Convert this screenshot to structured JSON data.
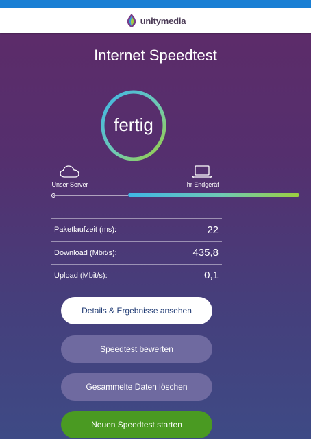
{
  "header": {
    "logo_text": "unitymedia"
  },
  "title": "Internet Speedtest",
  "gauge": {
    "status": "fertig"
  },
  "endpoints": {
    "server_label": "Unser Server",
    "device_label": "Ihr Endgerät"
  },
  "progress": {
    "fraction_complete": 0.69
  },
  "results": [
    {
      "label": "Paketlaufzeit (ms):",
      "value": "22"
    },
    {
      "label": "Download (Mbit/s):",
      "value": "435,8"
    },
    {
      "label": "Upload (Mbit/s):",
      "value": "0,1"
    }
  ],
  "buttons": {
    "details": "Details & Ergebnisse ansehen",
    "rate": "Speedtest bewerten",
    "clear": "Gesammelte Daten löschen",
    "new_test": "Neuen Speedtest starten"
  },
  "colors": {
    "brand_blue": "#1a7fd4",
    "gauge_start": "#3fb6e6",
    "gauge_end": "#9ccf3e",
    "secondary_button": "#6f6aa0",
    "primary_button": "#4a9a22"
  },
  "icons": {
    "server": "cloud-icon",
    "device": "laptop-icon",
    "logo": "unitymedia-logo-icon"
  }
}
